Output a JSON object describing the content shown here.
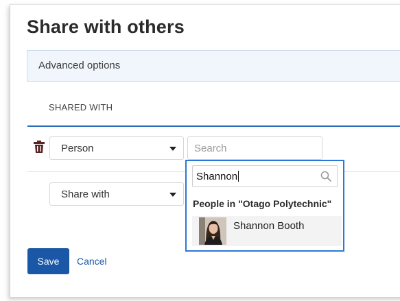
{
  "dialog": {
    "title": "Share with others",
    "advanced_options_label": "Advanced options"
  },
  "shared_with": {
    "heading": "SHARED WITH",
    "rows": [
      {
        "type_select": "Person",
        "search_placeholder": "Search"
      },
      {
        "type_select": "Share with"
      }
    ]
  },
  "people_picker": {
    "query": "Shannon",
    "group_label": "People in \"Otago Polytechnic\"",
    "results": [
      {
        "name": "Shannon Booth"
      }
    ]
  },
  "actions": {
    "save_label": "Save",
    "cancel_label": "Cancel"
  },
  "colors": {
    "accent": "#1a57a6",
    "focus_border": "#2a78d4",
    "advanced_bg": "#f0f6fc",
    "trash_icon": "#5a2424"
  },
  "icons": [
    "trash-icon",
    "chevron-down-icon",
    "search-icon"
  ]
}
